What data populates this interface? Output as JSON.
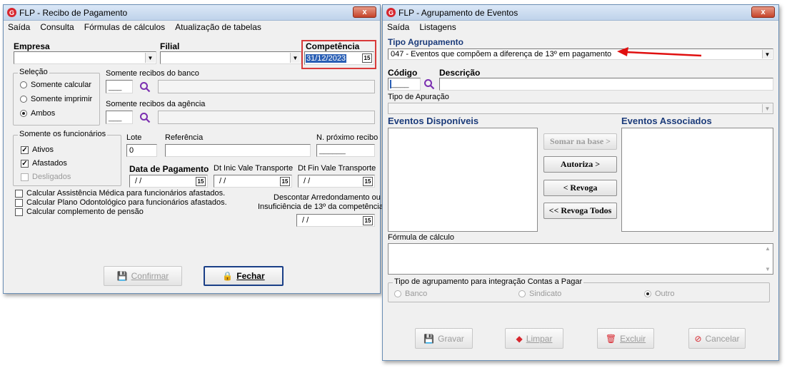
{
  "left_window": {
    "title": "FLP - Recibo de Pagamento",
    "close": "x",
    "menu": [
      "Saída",
      "Consulta",
      "Fórmulas de cálculos",
      "Atualização de tabelas"
    ],
    "empresa_label": "Empresa",
    "filial_label": "Filial",
    "competencia_label": "Competência",
    "competencia_value": "31/12/2023",
    "selecao": {
      "title": "Seleção",
      "options": [
        "Somente calcular",
        "Somente imprimir",
        "Ambos"
      ],
      "selected": "Ambos"
    },
    "banco_label": "Somente recibos do banco",
    "agencia_label": "Somente recibos da agência",
    "funcionarios": {
      "title": "Somente os funcionários",
      "options": [
        {
          "label": "Ativos",
          "checked": true,
          "enabled": true
        },
        {
          "label": "Afastados",
          "checked": true,
          "enabled": true
        },
        {
          "label": "Desligados",
          "checked": false,
          "enabled": false
        }
      ]
    },
    "lote_label": "Lote",
    "lote_value": "0",
    "referencia_label": "Referência",
    "proximo_recibo_label": "N. próximo recibo",
    "data_pagamento_label": "Data de Pagamento",
    "dt_inic_label": "Dt Inic Vale Transporte",
    "dt_fin_label": "Dt Fin Vale Transporte",
    "empty_date": "/ /",
    "cal_glyph": "15",
    "checks": [
      "Calcular Assistência Médica para funcionários afastados.",
      "Calcular Plano Odontológico para funcionários afastados.",
      "Calcular complemento de pensão"
    ],
    "descontar_label_1": "Descontar Arredondamento ou",
    "descontar_label_2": "Insuficiência de 13º da competência",
    "confirmar_label": "Confirmar",
    "fechar_label": "Fechar"
  },
  "right_window": {
    "title": "FLP - Agrupamento de Eventos",
    "close": "x",
    "menu": [
      "Saída",
      "Listagens"
    ],
    "tipo_agrupamento_label": "Tipo Agrupamento",
    "tipo_agrupamento_value": "047 - Eventos que compõem a diferença de 13º em pagamento",
    "codigo_label": "Código",
    "descricao_label": "Descrição",
    "tipo_apuracao_label": "Tipo de Apuração",
    "eventos_disponiveis_label": "Eventos Disponíveis",
    "eventos_associados_label": "Eventos Associados",
    "somar_label": "Somar  na base >",
    "autoriza_label": "Autoriza >",
    "revoga_label": "< Revoga",
    "revoga_todos_label": "<< Revoga Todos",
    "formula_label": "Fórmula de cálculo",
    "integracao": {
      "title": "Tipo de agrupamento para integração Contas a Pagar",
      "options": [
        "Banco",
        "Sindicato",
        "Outro"
      ],
      "selected": "Outro"
    },
    "gravar_label": "Gravar",
    "limpar_label": "Limpar",
    "excluir_label": "Excluir",
    "cancelar_label": "Cancelar"
  },
  "colors": {
    "accent_red": "#d7262e",
    "label_blue": "#1b3b7a",
    "annotation_arrow": "#e01010"
  },
  "icons": [
    "app-logo-icon",
    "close-icon",
    "dropdown-arrow-icon",
    "calendar-icon",
    "search-icon",
    "save-icon",
    "lock-icon",
    "eraser-icon",
    "trash-icon",
    "cancel-icon"
  ]
}
